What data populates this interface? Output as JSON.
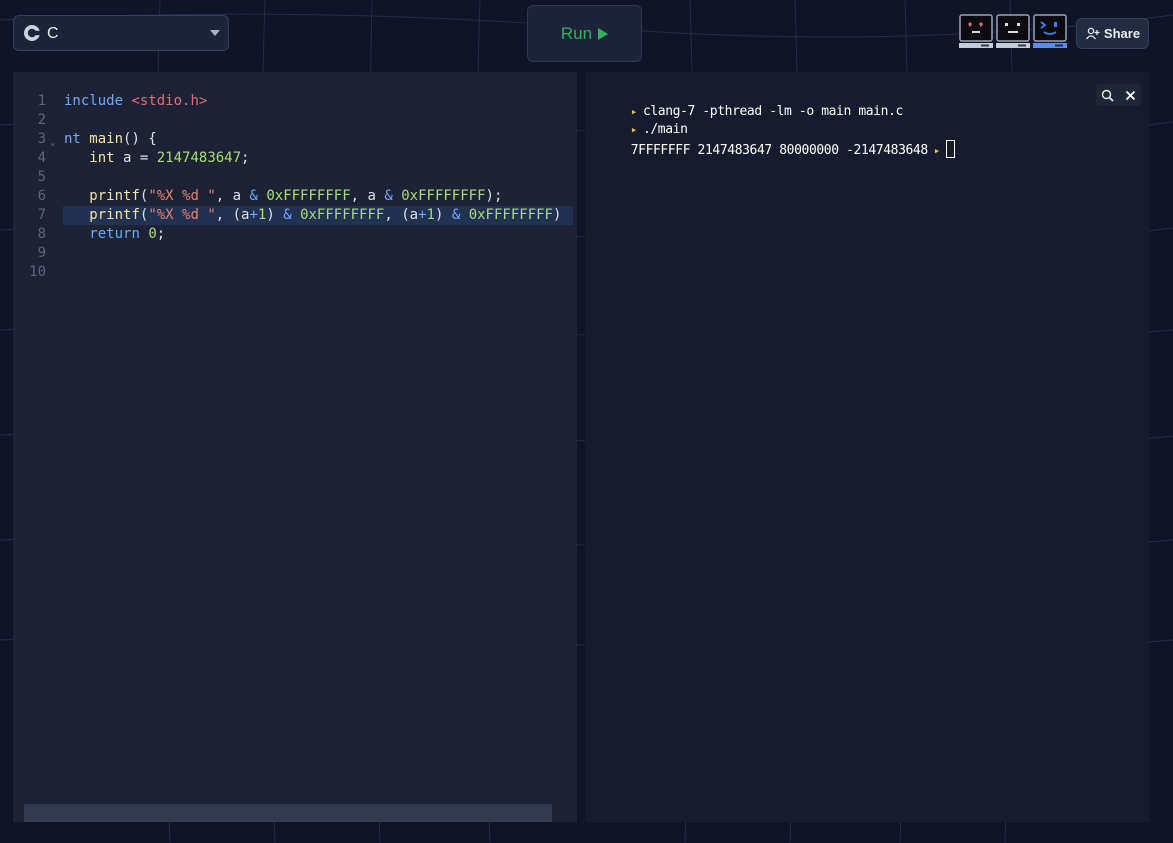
{
  "header": {
    "language": "C",
    "run_label": "Run",
    "share_label": "Share"
  },
  "editor": {
    "lines": [
      {
        "n": "1",
        "tokens": [
          {
            "c": "tok-kw",
            "t": "include "
          },
          {
            "c": "tok-inc",
            "t": "<stdio.h>"
          }
        ]
      },
      {
        "n": "2",
        "tokens": []
      },
      {
        "n": "3",
        "fold": true,
        "tokens": [
          {
            "c": "tok-kw",
            "t": "nt "
          },
          {
            "c": "tok-fn",
            "t": "main"
          },
          {
            "c": "",
            "t": "() {"
          }
        ]
      },
      {
        "n": "4",
        "tokens": [
          {
            "c": "",
            "t": "   "
          },
          {
            "c": "tok-fn",
            "t": "int"
          },
          {
            "c": "",
            "t": " a = "
          },
          {
            "c": "tok-num",
            "t": "2147483647"
          },
          {
            "c": "",
            "t": ";"
          }
        ]
      },
      {
        "n": "5",
        "tokens": []
      },
      {
        "n": "6",
        "tokens": [
          {
            "c": "",
            "t": "   "
          },
          {
            "c": "tok-fn",
            "t": "printf"
          },
          {
            "c": "",
            "t": "("
          },
          {
            "c": "tok-str",
            "t": "\"%X %d \""
          },
          {
            "c": "",
            "t": ", a "
          },
          {
            "c": "tok-op",
            "t": "&"
          },
          {
            "c": "",
            "t": " "
          },
          {
            "c": "tok-num",
            "t": "0xFFFFFFFF"
          },
          {
            "c": "",
            "t": ", a "
          },
          {
            "c": "tok-op",
            "t": "&"
          },
          {
            "c": "",
            "t": " "
          },
          {
            "c": "tok-num",
            "t": "0xFFFFFFFF"
          },
          {
            "c": "",
            "t": ");"
          }
        ]
      },
      {
        "n": "7",
        "active": true,
        "tokens": [
          {
            "c": "",
            "t": "   "
          },
          {
            "c": "tok-fn",
            "t": "printf"
          },
          {
            "c": "",
            "t": "("
          },
          {
            "c": "tok-str",
            "t": "\"%X %d \""
          },
          {
            "c": "",
            "t": ", (a"
          },
          {
            "c": "tok-op",
            "t": "+"
          },
          {
            "c": "tok-num",
            "t": "1"
          },
          {
            "c": "",
            "t": ") "
          },
          {
            "c": "tok-op",
            "t": "&"
          },
          {
            "c": "",
            "t": " "
          },
          {
            "c": "tok-num",
            "t": "0xFFFFFFFF"
          },
          {
            "c": "",
            "t": ", (a"
          },
          {
            "c": "tok-op",
            "t": "+"
          },
          {
            "c": "tok-num",
            "t": "1"
          },
          {
            "c": "",
            "t": ") "
          },
          {
            "c": "tok-op",
            "t": "&"
          },
          {
            "c": "",
            "t": " "
          },
          {
            "c": "tok-num",
            "t": "0xFFFFFFFF"
          },
          {
            "c": "",
            "t": ")"
          }
        ]
      },
      {
        "n": "8",
        "tokens": [
          {
            "c": "",
            "t": "   "
          },
          {
            "c": "tok-kw",
            "t": "return"
          },
          {
            "c": "",
            "t": " "
          },
          {
            "c": "tok-num",
            "t": "0"
          },
          {
            "c": "",
            "t": ";"
          }
        ]
      },
      {
        "n": "9",
        "tokens": []
      },
      {
        "n": "10",
        "tokens": []
      }
    ]
  },
  "terminal": {
    "command1": "clang-7 -pthread -lm -o main main.c",
    "command2": "./main",
    "output": "7FFFFFFF 2147483647 80000000 -2147483648"
  },
  "colors": {
    "accent_run": "#2db35d",
    "prompt": "#e8c33b",
    "background": "#0f1527"
  }
}
